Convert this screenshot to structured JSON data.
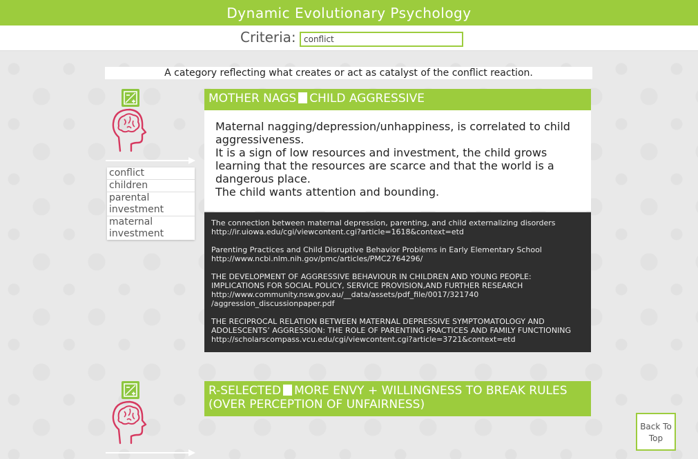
{
  "app": {
    "title": "Dynamic Evolutionary Psychology"
  },
  "criteria": {
    "label": "Criteria:",
    "value": "conflict"
  },
  "category_description": "A category reflecting what creates or act as catalyst of the conflict reaction.",
  "entries": [
    {
      "title_left": "MOTHER NAGS",
      "title_right": "CHILD AGGRESSIVE",
      "body": [
        "Maternal nagging/depression/unhappiness, is correlated to child aggressiveness.",
        "It is a sign of low resources and investment, the child grows learning that the resources are scarce and that the world is a dangerous place.",
        "The child wants attention and bounding."
      ],
      "tags": [
        "conflict",
        "children",
        "parental investment",
        "maternal investment"
      ],
      "references": [
        {
          "title": "The connection between maternal depression, parenting, and child externalizing disorders",
          "url": "http://ir.uiowa.edu/cgi/viewcontent.cgi?article=1618&context=etd"
        },
        {
          "title": "Parenting Practices and Child Disruptive Behavior Problems in Early Elementary School",
          "url": "http://www.ncbi.nlm.nih.gov/pmc/articles/PMC2764296/"
        },
        {
          "title": "THE DEVELOPMENT OF AGGRESSIVE BEHAVIOUR IN CHILDREN AND YOUNG PEOPLE: IMPLICATIONS FOR SOCIAL POLICY, SERVICE PROVISION,AND FURTHER RESEARCH",
          "url": "http://www.community.nsw.gov.au/__data/assets/pdf_file/0017/321740 /aggression_discussionpaper.pdf"
        },
        {
          "title": "THE RECIPROCAL RELATION BETWEEN MATERNAL DEPRESSIVE SYMPTOMATOLOGY AND ADOLESCENTS’ AGGRESSION: THE ROLE OF PARENTING PRACTICES AND FAMILY FUNCTIONING",
          "url": "http://scholarscompass.vcu.edu/cgi/viewcontent.cgi?article=3721&context=etd"
        }
      ]
    },
    {
      "title_left": "R-SELECTED",
      "title_right": "MORE ENVY + WILLINGNESS TO BREAK RULES (OVER PERCEPTION OF UNFAIRNESS)"
    }
  ],
  "icons": {
    "entry_badge": "plus-minus-icon",
    "entry_symbol": "brain-head-icon",
    "arrow": "arrow-right-icon"
  },
  "back_to_top": {
    "label": "Back To Top"
  },
  "colors": {
    "accent": "#9ccc3d",
    "brain": "#d6385f",
    "refs_bg": "#2f2f2f"
  }
}
